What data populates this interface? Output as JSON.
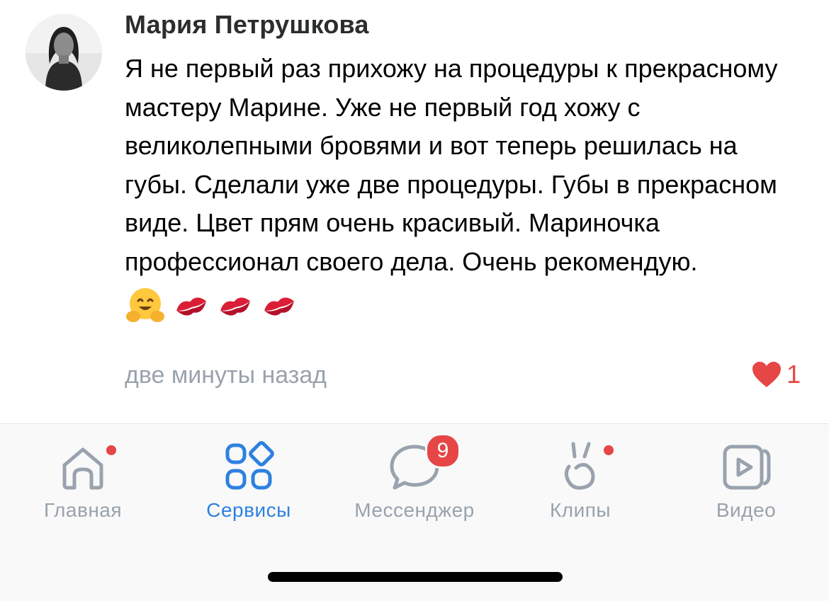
{
  "comment": {
    "author": "Мария Петрушкова",
    "text": "Я не первый раз прихожу на процедуры к прекрасному мастеру Марине. Уже не первый год хожу с великолепными бровями и вот теперь решилась на губы. Сделали уже две процедуры. Губы в прекрасном виде. Цвет прям очень красивый. Мариночка профессионал своего дела. Очень рекомендую.",
    "emojis": [
      "hugging-face-emoji",
      "kiss-mark-emoji",
      "kiss-mark-emoji",
      "kiss-mark-emoji"
    ],
    "timestamp": "две минуты назад",
    "likes": "1"
  },
  "tabbar": {
    "tabs": [
      {
        "label": "Главная",
        "icon": "home-icon",
        "active": false,
        "dot": true
      },
      {
        "label": "Сервисы",
        "icon": "services-icon",
        "active": true,
        "dot": false
      },
      {
        "label": "Мессенджер",
        "icon": "messenger-icon",
        "active": false,
        "badge": "9"
      },
      {
        "label": "Клипы",
        "icon": "clips-icon",
        "active": false,
        "dot": true
      },
      {
        "label": "Видео",
        "icon": "video-icon",
        "active": false,
        "dot": false
      }
    ]
  },
  "colors": {
    "accent": "#2d81e0",
    "inactive": "#99a2ad",
    "notification": "#e64646",
    "like": "#e64646"
  }
}
